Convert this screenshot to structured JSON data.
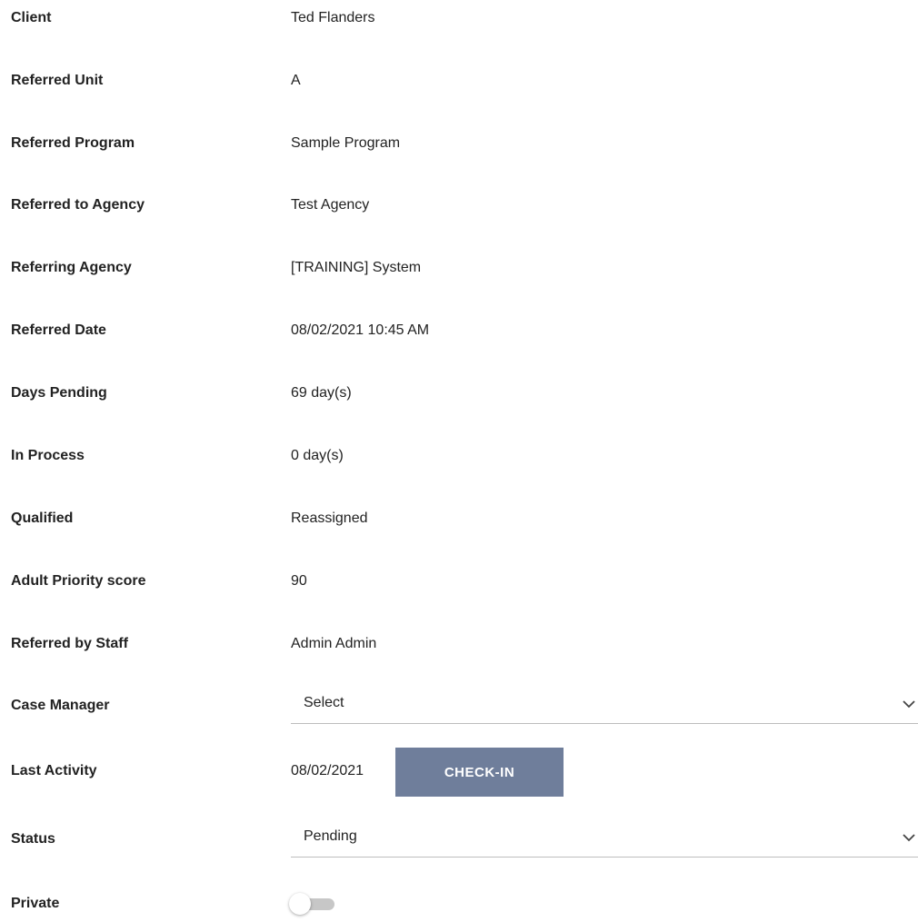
{
  "fields": [
    {
      "label": "Client",
      "value": "Ted Flanders"
    },
    {
      "label": "Referred Unit",
      "value": "A"
    },
    {
      "label": "Referred Program",
      "value": "Sample Program"
    },
    {
      "label": "Referred to Agency",
      "value": "Test Agency"
    },
    {
      "label": "Referring Agency",
      "value": "[TRAINING] System"
    },
    {
      "label": "Referred Date",
      "value": "08/02/2021 10:45 AM"
    },
    {
      "label": "Days Pending",
      "value": "69 day(s)"
    },
    {
      "label": "In Process",
      "value": "0 day(s)"
    },
    {
      "label": "Qualified",
      "value": "Reassigned"
    },
    {
      "label": "Adult Priority score",
      "value": "90"
    },
    {
      "label": "Referred by Staff",
      "value": "Admin Admin"
    }
  ],
  "case_manager": {
    "label": "Case Manager",
    "selected": "Select",
    "icon": "chevron-down-icon"
  },
  "last_activity": {
    "label": "Last Activity",
    "value": "08/02/2021",
    "button_label": "CHECK-IN"
  },
  "status": {
    "label": "Status",
    "selected": "Pending",
    "icon": "chevron-down-icon"
  },
  "private": {
    "label": "Private",
    "on": false
  },
  "colors": {
    "button_bg": "#6f7e9b",
    "text": "#222222",
    "toggle_track": "#c7c7c7"
  }
}
